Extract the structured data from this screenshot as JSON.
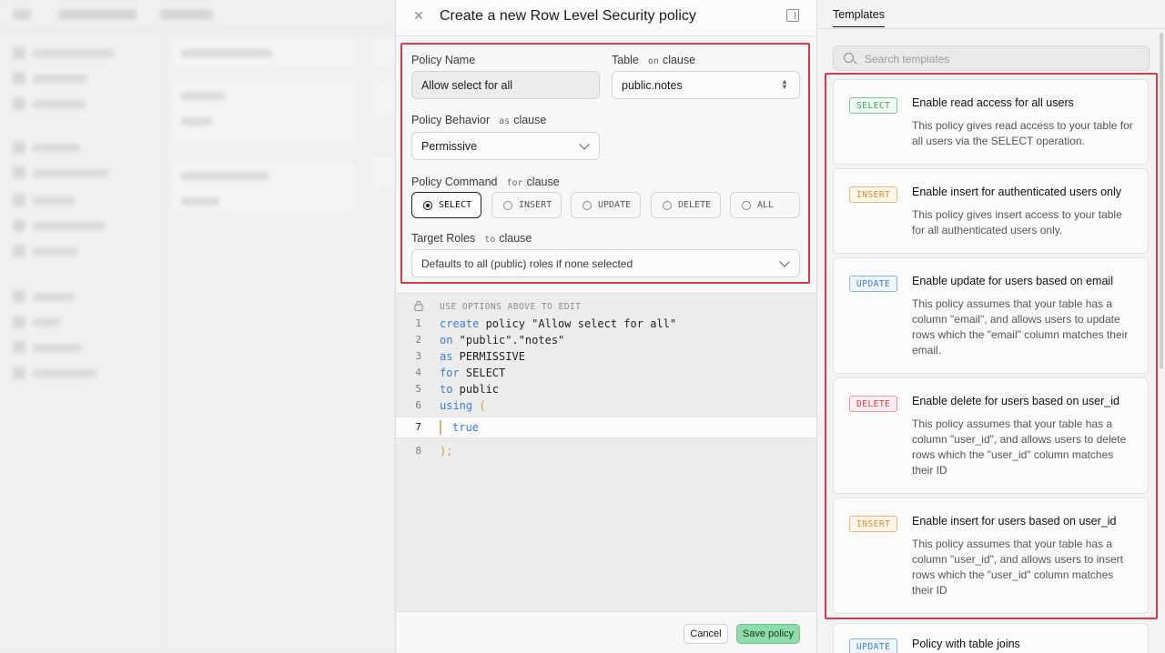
{
  "dialog": {
    "title": "Create a new Row Level Security policy",
    "close_icon": "close-icon",
    "toggle_icon": "panel-toggle-icon"
  },
  "form": {
    "policy_name": {
      "label": "Policy Name",
      "value": "Allow select for all"
    },
    "table": {
      "label": "Table",
      "clause": "on",
      "clause_word": "clause",
      "value": "public.notes"
    },
    "behavior": {
      "label": "Policy Behavior",
      "clause": "as",
      "clause_word": "clause",
      "value": "Permissive"
    },
    "command": {
      "label": "Policy Command",
      "clause": "for",
      "clause_word": "clause",
      "options": [
        "SELECT",
        "INSERT",
        "UPDATE",
        "DELETE",
        "ALL"
      ],
      "selected": "SELECT"
    },
    "roles": {
      "label": "Target Roles",
      "clause": "to",
      "clause_word": "clause",
      "placeholder": "Defaults to all (public) roles if none selected"
    }
  },
  "editor": {
    "hint": "USE OPTIONS ABOVE TO EDIT",
    "lines": [
      {
        "num": "1",
        "kw": "create",
        "rest": " policy \"Allow select for all\""
      },
      {
        "num": "2",
        "kw": "on",
        "rest": " \"public\".\"notes\""
      },
      {
        "num": "3",
        "kw": "as",
        "rest": " PERMISSIVE"
      },
      {
        "num": "4",
        "kw": "for",
        "rest": " SELECT"
      },
      {
        "num": "5",
        "kw": "to",
        "rest": " public"
      },
      {
        "num": "6",
        "kw": "using",
        "rest": " ("
      },
      {
        "num": "7",
        "kw": "",
        "rest": "true"
      },
      {
        "num": "8",
        "kw": "",
        "rest": ");"
      }
    ]
  },
  "footer": {
    "cancel": "Cancel",
    "save": "Save policy"
  },
  "templates": {
    "tab": "Templates",
    "search_placeholder": "Search templates",
    "items": [
      {
        "badge": "SELECT",
        "title": "Enable read access for all users",
        "desc": "This policy gives read access to your table for all users via the SELECT operation."
      },
      {
        "badge": "INSERT",
        "title": "Enable insert for authenticated users only",
        "desc": "This policy gives insert access to your table for all authenticated users only."
      },
      {
        "badge": "UPDATE",
        "title": "Enable update for users based on email",
        "desc": "This policy assumes that your table has a column \"email\", and allows users to update rows which the \"email\" column matches their email."
      },
      {
        "badge": "DELETE",
        "title": "Enable delete for users based on user_id",
        "desc": "This policy assumes that your table has a column \"user_id\", and allows users to delete rows which the \"user_id\" column matches their ID"
      },
      {
        "badge": "INSERT",
        "title": "Enable insert for users based on user_id",
        "desc": "This policy assumes that your table has a column \"user_id\", and allows users to insert rows which the \"user_id\" column matches their ID"
      },
      {
        "badge": "UPDATE",
        "title": "Policy with table joins",
        "desc": ""
      }
    ]
  },
  "colors": {
    "highlight": "#d8394d",
    "select": "#3f9e63",
    "insert": "#d98b2b",
    "update": "#3b7bd6",
    "delete": "#d8394d",
    "save_button": "#8fdca9"
  }
}
